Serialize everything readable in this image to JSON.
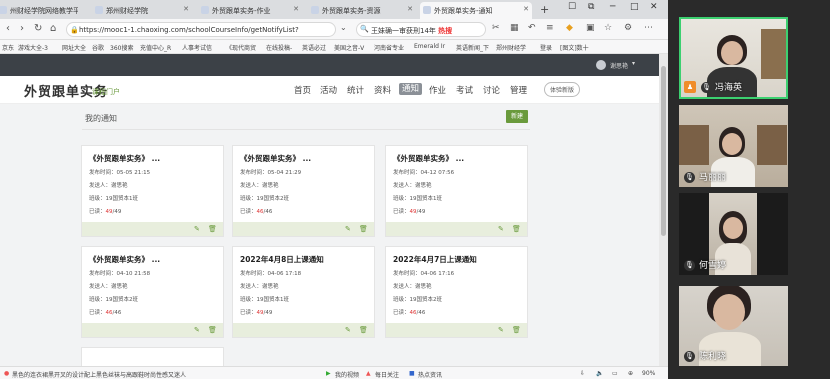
{
  "browser": {
    "tabs": [
      {
        "label": "州财经学院网络教学平台",
        "active": false
      },
      {
        "label": "郑州财经学院",
        "active": false
      },
      {
        "label": "外贸跟单实务-作业",
        "active": false
      },
      {
        "label": "外贸跟单实务-资源",
        "active": false
      },
      {
        "label": "外贸跟单实务-通知",
        "active": true
      }
    ],
    "newtab": "+",
    "url": "https://mooc1-1.chaoxing.com/schoolCourseInfo/getNotifyList?",
    "search_text": "王妹确一审获刑14年",
    "search_hot": "热搜",
    "bookmarks": [
      "京东",
      "游戏大全-3",
      "网址大全",
      "谷歌",
      "360搜索",
      "充值中心_R",
      "人事考试信",
      "《现代商贸",
      "在线投稿-",
      "英语必过",
      "美国之音-V",
      "河南省专业",
      "Emerald Ir",
      "英语新闻_下",
      "郑州财经学",
      "登录",
      "[图文]数十"
    ],
    "zoom": "90%"
  },
  "site": {
    "user_name": "谢思艳",
    "course_title": "外贸跟单实务",
    "portal_label": "课程门户",
    "nav": [
      "首页",
      "活动",
      "统计",
      "资料",
      "通知",
      "作业",
      "考试",
      "讨论",
      "管理"
    ],
    "nav_active": "通知",
    "trial_label": "体验新版",
    "notify_title": "我的通知",
    "new_button": "新建"
  },
  "cards": [
    {
      "title": "《外贸跟单实务》 ...",
      "time": "发布时间：05-05 21:15",
      "sender": "发送人：谢思艳",
      "class": "班级：19国贸本1班",
      "read_label": "已读：",
      "read_count": "49",
      "read_total": "/49"
    },
    {
      "title": "《外贸跟单实务》 ...",
      "time": "发布时间：05-04 21:29",
      "sender": "发送人：谢思艳",
      "class": "班级：19国贸本2班",
      "read_label": "已读：",
      "read_count": "46",
      "read_total": "/46"
    },
    {
      "title": "《外贸跟单实务》 ...",
      "time": "发布时间：04-12 07:56",
      "sender": "发送人：谢思艳",
      "class": "班级：19国贸本1班",
      "read_label": "已读：",
      "read_count": "49",
      "read_total": "/49"
    },
    {
      "title": "《外贸跟单实务》 ...",
      "time": "发布时间：04-10 21:58",
      "sender": "发送人：谢思艳",
      "class": "班级：19国贸本2班",
      "read_label": "已读：",
      "read_count": "46",
      "read_total": "/46"
    },
    {
      "title": "2022年4月8日上课通知",
      "time": "发布时间：04-06 17:18",
      "sender": "发送人：谢思艳",
      "class": "班级：19国贸本1班",
      "read_label": "已读：",
      "read_count": "49",
      "read_total": "/49"
    },
    {
      "title": "2022年4月7日上课通知",
      "time": "发布时间：04-06 17:16",
      "sender": "发送人：谢思艳",
      "class": "班级：19国贸本2班",
      "read_label": "已读：",
      "read_count": "46",
      "read_total": "/46"
    }
  ],
  "statusbar": {
    "news": "黑色的连衣裙黑开叉的设计配上黑色丝袜与高跟鞋时尚性感又迷人",
    "items": [
      "我的视频",
      "每日关注",
      "热点资讯"
    ]
  },
  "participants": [
    {
      "name": "冯海英",
      "speaking": true,
      "host": true
    },
    {
      "name": "马丽丽",
      "speaking": false,
      "host": false
    },
    {
      "name": "何雪婷",
      "speaking": false,
      "host": false
    },
    {
      "name": "陈利晓",
      "speaking": false,
      "host": false
    }
  ],
  "colors": {
    "accent_green": "#6a9a3c",
    "read_red": "#dd3333",
    "speaking_border": "#3cd070"
  }
}
